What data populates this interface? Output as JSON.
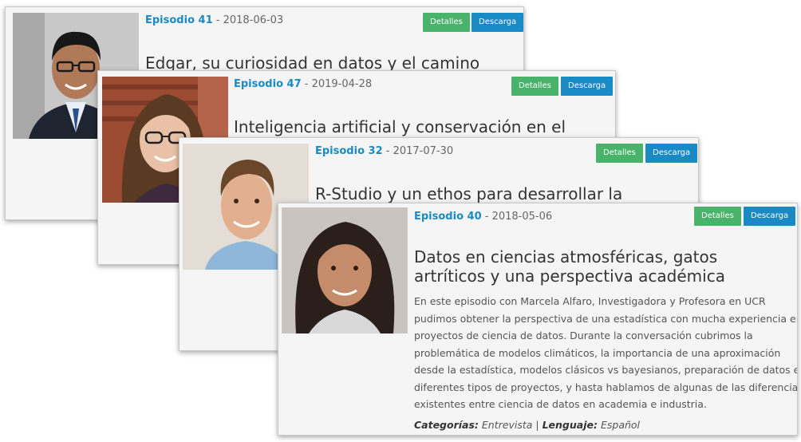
{
  "cards": [
    {
      "episode_label": "Episodio 41",
      "separator": " - ",
      "date": "2018-06-03",
      "title": "Edgar, su curiosidad en datos y el camino",
      "details_label": "Detalles",
      "download_label": "Descarga",
      "photo": "portrait-man-glasses-suit"
    },
    {
      "episode_label": "Episodio 47",
      "separator": " - ",
      "date": "2019-04-28",
      "title": "Inteligencia artificial y conservación en el",
      "details_label": "Detalles",
      "download_label": "Descarga",
      "photo": "portrait-woman-glasses"
    },
    {
      "episode_label": "Episodio 32",
      "separator": " - ",
      "date": "2017-07-30",
      "title": "R-Studio y un ethos para desarrollar la",
      "details_label": "Detalles",
      "download_label": "Descarga",
      "photo": "portrait-man-smiling"
    },
    {
      "episode_label": "Episodio 40",
      "separator": " - ",
      "date": "2018-05-06",
      "title_line1": "Datos en ciencias atmosféricas, gatos",
      "title_line2": "artríticos y una perspectiva académica",
      "description_lines": [
        "En este episodio con Marcela Alfaro, Investigadora y Profesora en UCR",
        "pudimos obtener la perspectiva de una estadística con mucha experiencia en",
        "proyectos de ciencia de datos. Durante la conversación cubrimos la",
        "problemática de modelos climáticos, la importancia de una aproximación",
        "desde la estadística, modelos clásicos vs bayesianos, preparación de datos en",
        "diferentes tipos de proyectos, y hasta hablamos de algunas de las diferencias",
        "existentes entre ciencia de datos en academia e industria."
      ],
      "categories_label": "Categorías:",
      "categories_value": "Entrevista",
      "pipe": "|",
      "language_label": "Lenguaje:",
      "language_value": "Español",
      "details_label": "Detalles",
      "download_label": "Descarga",
      "photo": "portrait-woman-dark-hair"
    }
  ],
  "colors": {
    "episode_link": "#1a8ac5",
    "details_button": "#49b36b",
    "download_button": "#1a8ac5",
    "card_bg": "#f5f5f5"
  }
}
